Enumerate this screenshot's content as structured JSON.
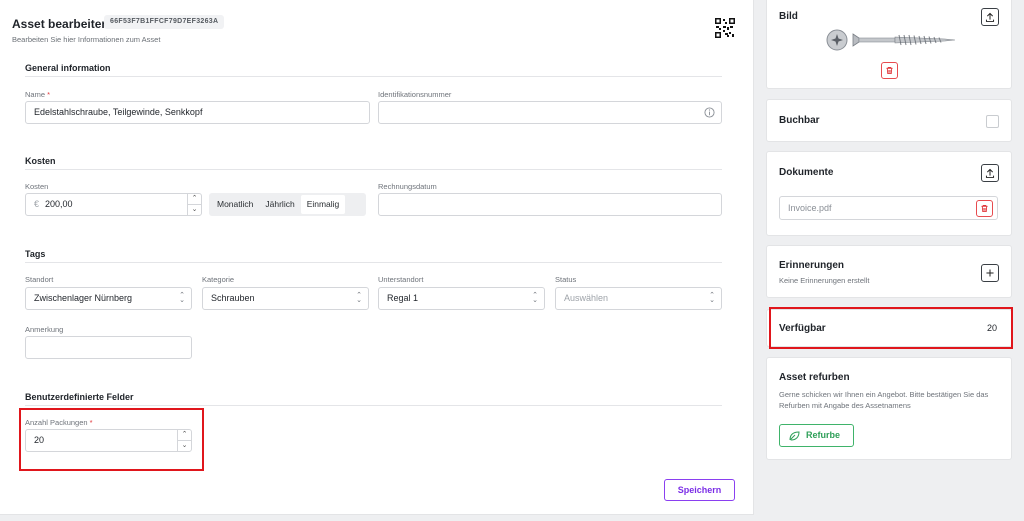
{
  "header": {
    "title": "Asset bearbeiten",
    "asset_id": "66F53F7B1FFCF79D7EF3263A",
    "subtitle": "Bearbeiten Sie hier Informationen zum Asset"
  },
  "general": {
    "section_title": "General information",
    "name_label": "Name",
    "required_mark": "*",
    "name_value": "Edelstahlschraube, Teilgewinde, Senkkopf",
    "id_number_label": "Identifikationsnummer",
    "id_number_value": ""
  },
  "costs": {
    "section_title": "Kosten",
    "cost_label": "Kosten",
    "currency_symbol": "€",
    "cost_value": "200,00",
    "intervals": [
      "Monatlich",
      "Jährlich",
      "Einmalig"
    ],
    "active_interval": "Einmalig",
    "invoice_date_label": "Rechnungsdatum",
    "invoice_date_value": ""
  },
  "tags": {
    "section_title": "Tags",
    "location_label": "Standort",
    "location_value": "Zwischenlager Nürnberg",
    "category_label": "Kategorie",
    "category_value": "Schrauben",
    "sublocation_label": "Unterstandort",
    "sublocation_value": "Regal 1",
    "status_label": "Status",
    "status_placeholder": "Auswählen",
    "note_label": "Anmerkung",
    "note_value": ""
  },
  "custom_fields": {
    "section_title": "Benutzerdefinierte Felder",
    "packages_label": "Anzahl Packungen",
    "packages_value": "20"
  },
  "save_label": "Speichern",
  "sidebar": {
    "image_title": "Bild",
    "bookable_title": "Buchbar",
    "bookable_checked": false,
    "documents_title": "Dokumente",
    "document_file": "Invoice.pdf",
    "reminders_title": "Erinnerungen",
    "reminders_sub": "Keine Erinnerungen erstellt",
    "available_title": "Verfügbar",
    "available_count": "20",
    "refurb_title": "Asset refurben",
    "refurb_text": "Gerne schicken wir Ihnen ein Angebot. Bitte bestätigen Sie das Refurben mit Angabe des Assetnamens",
    "refurb_button": "Refurbe"
  },
  "colors": {
    "accent_purple": "#7b2ee6",
    "highlight_red": "#e0161c",
    "required_red": "#e0363a",
    "refurb_green": "#2e9f58"
  },
  "icons": [
    "qr-code-icon",
    "info-icon",
    "upload-icon",
    "trash-icon",
    "plus-icon",
    "leaf-icon",
    "chevron-up-down-icon"
  ]
}
